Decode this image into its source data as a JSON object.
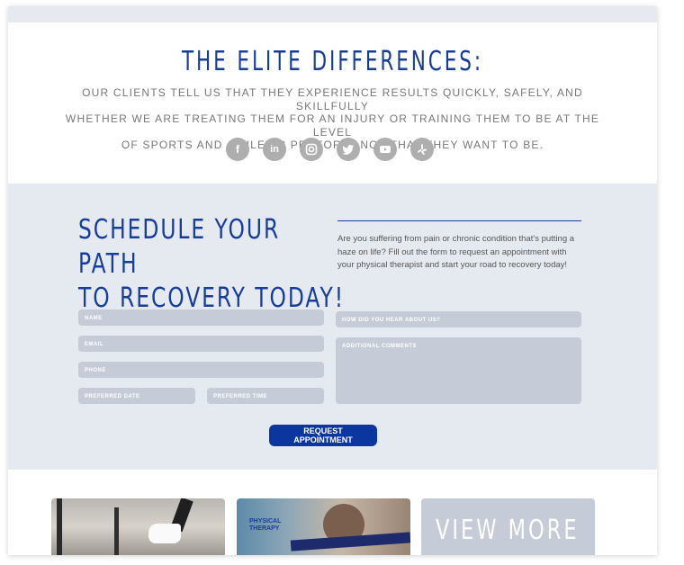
{
  "elite": {
    "title": "THE ELITE DIFFERENCES:",
    "lines": [
      "OUR CLIENTS TELL US THAT THEY EXPERIENCE RESULTS QUICKLY, SAFELY, AND SKILLFULLY",
      "WHETHER WE ARE TREATING THEM FOR AN INJURY OR TRAINING THEM TO BE AT THE LEVEL",
      "OF SPORTS AND ATHLETIC PERFORMANCE THAT THEY WANT TO BE."
    ]
  },
  "social": [
    {
      "icon": "facebook-icon",
      "glyph": "f"
    },
    {
      "icon": "linkedin-icon",
      "glyph": "in"
    },
    {
      "icon": "instagram-icon",
      "glyph": ""
    },
    {
      "icon": "twitter-icon",
      "glyph": ""
    },
    {
      "icon": "youtube-icon",
      "glyph": ""
    },
    {
      "icon": "yelp-icon",
      "glyph": ""
    }
  ],
  "schedule": {
    "heading_line1": "SCHEDULE YOUR PATH",
    "heading_line2": "TO RECOVERY TODAY!",
    "description": "Are you suffering from pain or chronic condition that's putting a haze on life? Fill out the form to request an appointment with your physical therapist and start your road to recovery today!",
    "fields": {
      "name": "NAME",
      "email": "EMAIL",
      "phone": "PHONE",
      "preferred_date": "PREFERRED DATE",
      "preferred_time": "PREFERRED TIME",
      "heard_about": "HOW DID YOU HEAR ABOUT US?",
      "comments": "ADDITIONAL COMMENTS"
    },
    "submit_label": "REQUEST APPOINTMENT"
  },
  "gallery": {
    "tile2_label_line1": "PHYSICAL",
    "tile2_label_line2": "THERAPY",
    "view_more": "VIEW MORE"
  },
  "colors": {
    "brand_blue": "#173d9c",
    "button_blue": "#0b36a0",
    "field_gray": "#c6ccd7",
    "section_bg": "#e5eaf0"
  }
}
